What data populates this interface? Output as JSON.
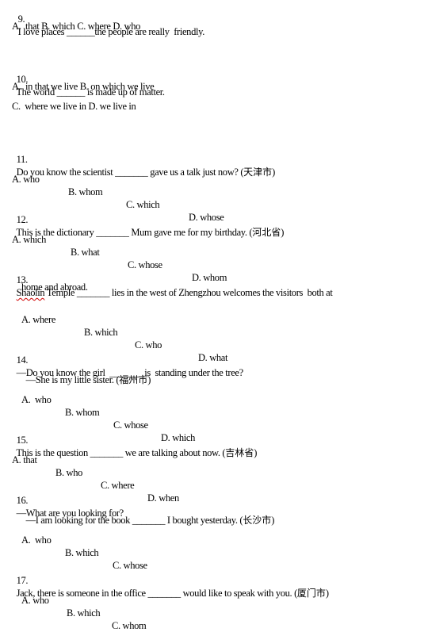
{
  "questions": [
    {
      "number": "9.",
      "stem": [
        "I love places ______the people are really  friendly."
      ],
      "options": [
        "A.  that B. which C. where D. who"
      ]
    },
    {
      "number": "10.",
      "stem": [
        "The world ______ is made up of matter."
      ],
      "options": [
        "A.  in that we live B. on which we live",
        "C.  where we live in D. we live in"
      ]
    },
    {
      "number": "11.",
      "stem": [
        "Do you know the scientist _______ gave us a talk just now? ("
      ],
      "source": "天津市",
      "options": [
        "A. who",
        "B. whom",
        "C. which",
        "D. whose"
      ]
    },
    {
      "number": "12.",
      "stem": [
        "This is the dictionary _______ Mum gave me for my birthday. ("
      ],
      "source": "河北省",
      "options": [
        "A. which",
        "B. what",
        "C. whose",
        "D. whom"
      ]
    },
    {
      "number": "13.",
      "stem_underlined": "Shaolin",
      "stem": [
        " Temple _______ lies in the west of Zhengzhou welcomes the visitors  both at",
        "home and abroad."
      ],
      "options": [
        "A. where",
        "B. which",
        "C. who",
        "D. what"
      ]
    },
    {
      "number": "14.",
      "stem": [
        "—Do you know the girl  _______ is  standing under the tree?",
        "—She is my little sister. ("
      ],
      "source": "福州市",
      "options": [
        "A.  who",
        "B. whom",
        "C. whose",
        "D. which"
      ]
    },
    {
      "number": "15.",
      "stem": [
        "This is the question _______ we are talking about now. ("
      ],
      "source": "吉林省",
      "options": [
        "A. that",
        "B. who",
        "C. where",
        "D. when"
      ]
    },
    {
      "number": "16.",
      "stem": [
        "—What are you looking for?",
        "—I am looking for the book _______ I bought yesterday. ("
      ],
      "source": "长沙市",
      "options": [
        "A.  who",
        "B. which",
        "C. whose"
      ]
    },
    {
      "number": "17.",
      "stem": [
        "Jack, there is someone in the office _______ would like to speak with you. ("
      ],
      "source": "厦门市",
      "options": [
        "A. who",
        "B. which",
        "C. whom"
      ]
    }
  ],
  "close_paren": ")"
}
